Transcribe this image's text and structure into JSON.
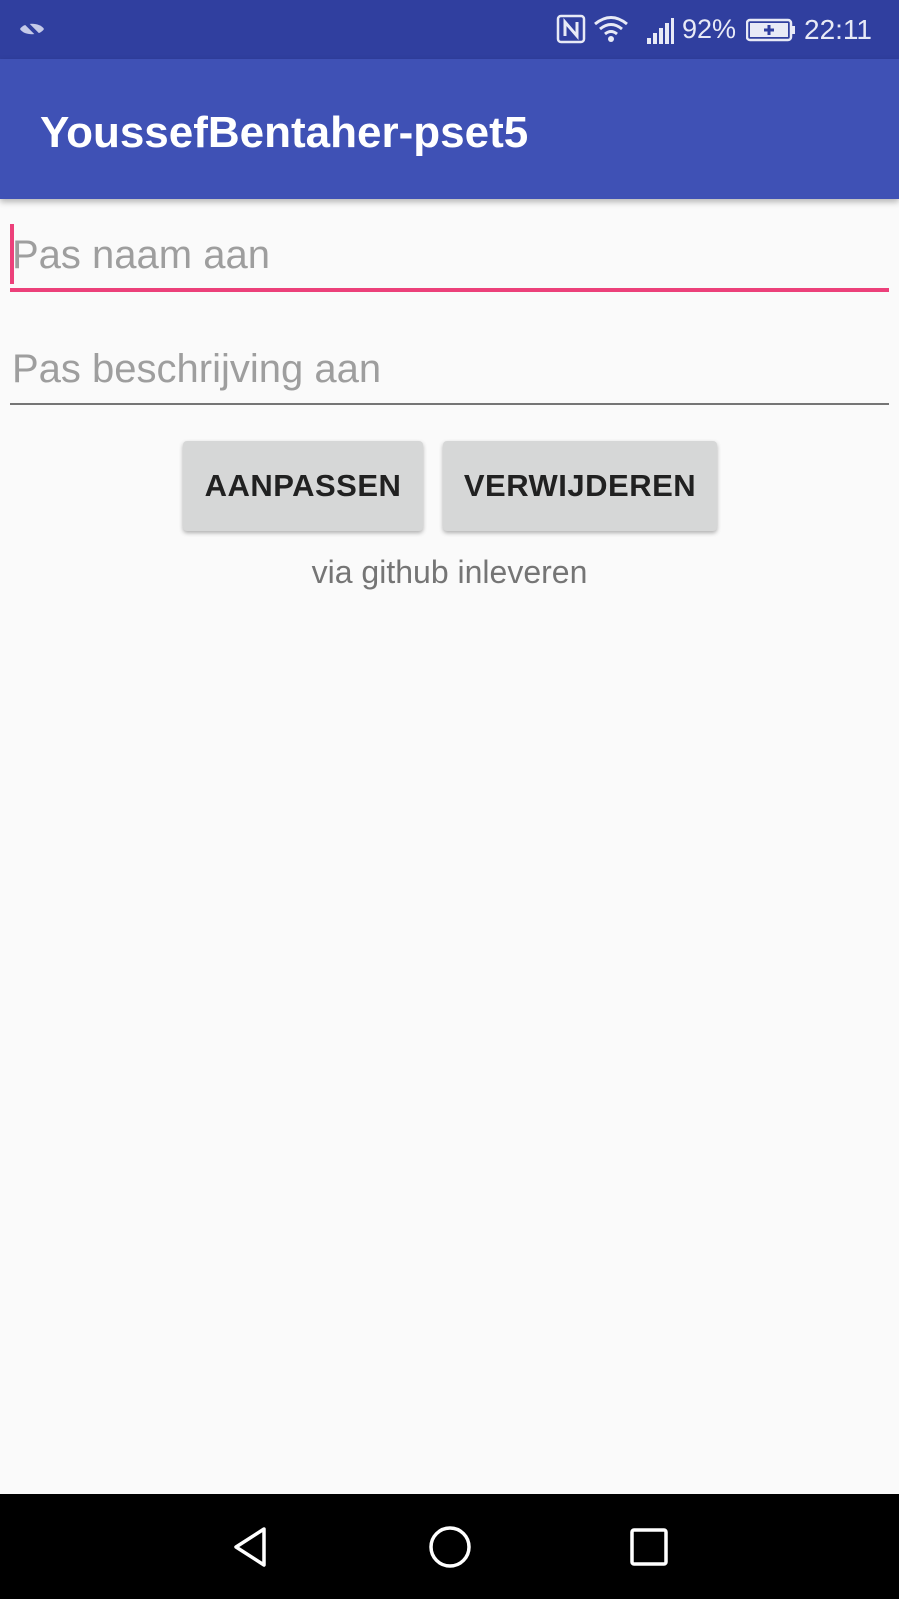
{
  "status_bar": {
    "left_icon": "eye-off-icon",
    "icons": [
      "nfc-icon",
      "wifi-icon",
      "signal-icon",
      "battery-charging-icon"
    ],
    "battery_percent": "92%",
    "time": "22:11"
  },
  "app_bar": {
    "title": "YoussefBentaher-pset5",
    "color": "#3f51b5"
  },
  "form": {
    "name_placeholder": "Pas naam aan",
    "name_value": "",
    "description_placeholder": "Pas beschrijving aan",
    "description_value": "",
    "focused_accent": "#ec407a"
  },
  "buttons": {
    "update_label": "AANPASSEN",
    "delete_label": "VERWIJDEREN"
  },
  "hint_text": "via github inleveren",
  "nav_bar": {
    "icons": [
      "back-icon",
      "home-icon",
      "recents-icon"
    ]
  }
}
